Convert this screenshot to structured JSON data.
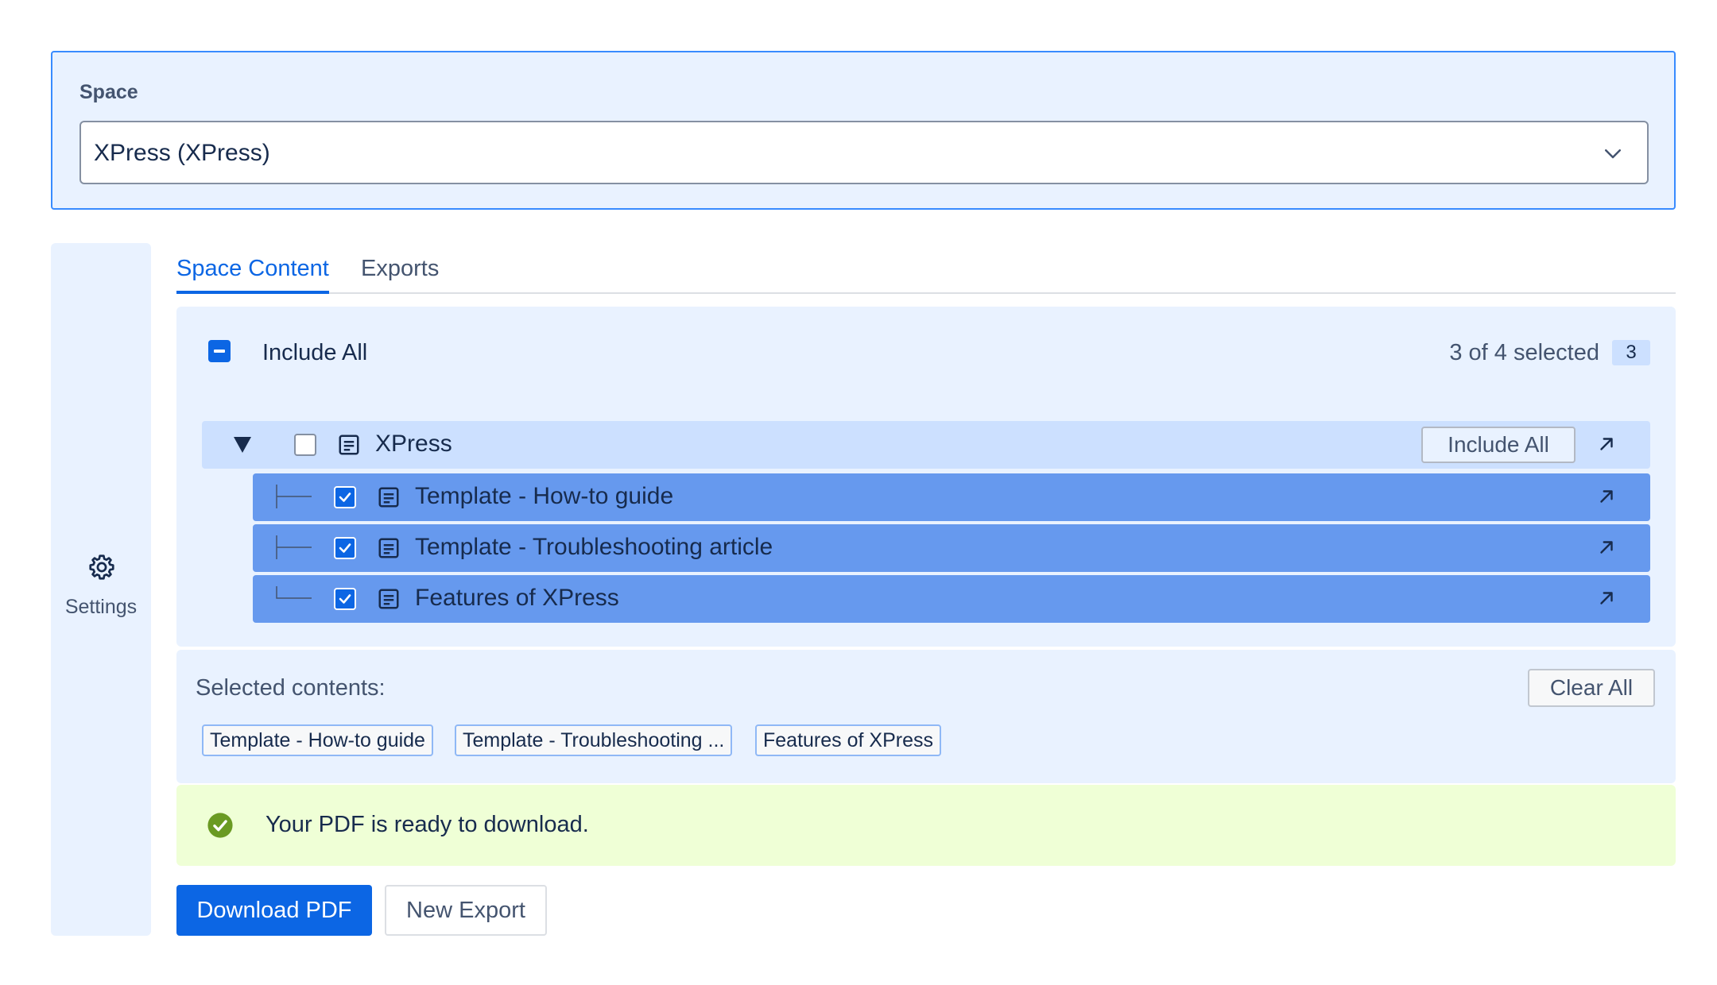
{
  "space": {
    "label": "Space",
    "selected_value": "XPress (XPress)"
  },
  "sidebar": {
    "settings_label": "Settings"
  },
  "tabs": [
    {
      "label": "Space Content",
      "active": true
    },
    {
      "label": "Exports",
      "active": false
    }
  ],
  "content": {
    "include_all_label": "Include All",
    "selected_count_text": "3 of 4 selected",
    "selected_badge": "3",
    "tree": {
      "root": {
        "label": "XPress",
        "checked": false,
        "include_all_button": "Include All"
      },
      "children": [
        {
          "label": "Template - How-to guide",
          "checked": true
        },
        {
          "label": "Template - Troubleshooting article",
          "checked": true
        },
        {
          "label": "Features of XPress",
          "checked": true
        }
      ]
    }
  },
  "selected_contents": {
    "label": "Selected contents:",
    "clear_all_button": "Clear All",
    "chips": [
      "Template - How-to guide",
      "Template - Troubleshooting ...",
      "Features of XPress"
    ]
  },
  "status": {
    "message": "Your PDF is ready to download."
  },
  "actions": {
    "download_button": "Download PDF",
    "new_export_button": "New Export"
  },
  "colors": {
    "accent": "#0c66e4",
    "panel_bg": "#e9f2ff",
    "selected_row": "#6699ee",
    "success_bg": "#efffd6",
    "success_icon": "#6a9a23"
  },
  "icons": {
    "dropdown": "chevron-down-icon",
    "settings": "gear-icon",
    "page": "page-icon",
    "open": "arrow-up-right-icon",
    "expand": "triangle-down-icon",
    "success": "check-circle-icon"
  }
}
